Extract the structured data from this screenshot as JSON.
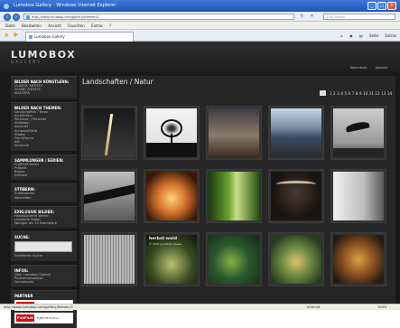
{
  "window": {
    "title": "Lumobox Gallery - Windows Internet Explorer"
  },
  "address": {
    "url": "http://www.lumobox.com/gallery/themen/1",
    "search_placeholder": "Live Search"
  },
  "menu": [
    "Datei",
    "Bearbeiten",
    "Ansicht",
    "Favoriten",
    "Extras",
    "?"
  ],
  "tab": {
    "label": "Lumobox Gallery"
  },
  "commands": [
    "Seite",
    "Extras"
  ],
  "site": {
    "logo": "LUMOBOX",
    "logo_sub": "GALLERY",
    "header_links": [
      "Warenkorb",
      "Kontakt"
    ],
    "page_title": "Landschaften / Natur",
    "pager": [
      "1",
      "2",
      "3",
      "4",
      "5",
      "6",
      "7",
      "8",
      "9",
      "10",
      "11",
      "12",
      "13",
      "14"
    ],
    "sidebar": {
      "box1": {
        "title": "BILDER NACH KÜNSTLERN:",
        "items": [
          "CLASSIC ARTISTS",
          "YOUNG ARTISTS",
          "MASTERS"
        ]
      },
      "box2": {
        "title": "BILDER NACH THEMEN:",
        "items": [
          "Landschaften / Natur",
          "Architektur",
          "Personen / Portraits",
          "Stillleben",
          "Abstrakt",
          "Schwarz/Weiß",
          "Städte",
          "Flora/Fauna",
          "Akt",
          "Dynamik"
        ]
      },
      "box3": {
        "title": "SAMMLUNGEN / SERIEN:",
        "items": [
          "FUJIFILM Archiv",
          "Präsent",
          "Basics",
          "Editions"
        ]
      },
      "box4": {
        "title": "STÖBERN:",
        "items": [
          "Zufallsbilder",
          "Neuheiten"
        ]
      },
      "box5": {
        "title": "EXKLUSIVE BILDER:",
        "items": [
          "Handsignierte Werke",
          "Limitierte Bilder",
          "Weniger als 10 Exemplare"
        ]
      },
      "search": {
        "title": "SUCHE:",
        "link": "Erweiterte Suche"
      },
      "box6": {
        "title": "INFOS:",
        "items": [
          "Über Lumobox Gallery",
          "Produktionsweise",
          "Formatwahl"
        ]
      },
      "partner": {
        "title": "PARTNER",
        "brand1": "FUJIFILM",
        "brand1_text": "FUJIFILM",
        "brand2": "FUJIFILM",
        "brand2_text": "FUJIFILM Partner"
      }
    },
    "grid_overlay": {
      "title": "herbst-wald",
      "credit": "© 2007 Jonathan Haase"
    }
  },
  "status": {
    "url": "http://www.lumobox.com/gallery/themen/1",
    "zone": "Internet",
    "zoom": "100%"
  }
}
